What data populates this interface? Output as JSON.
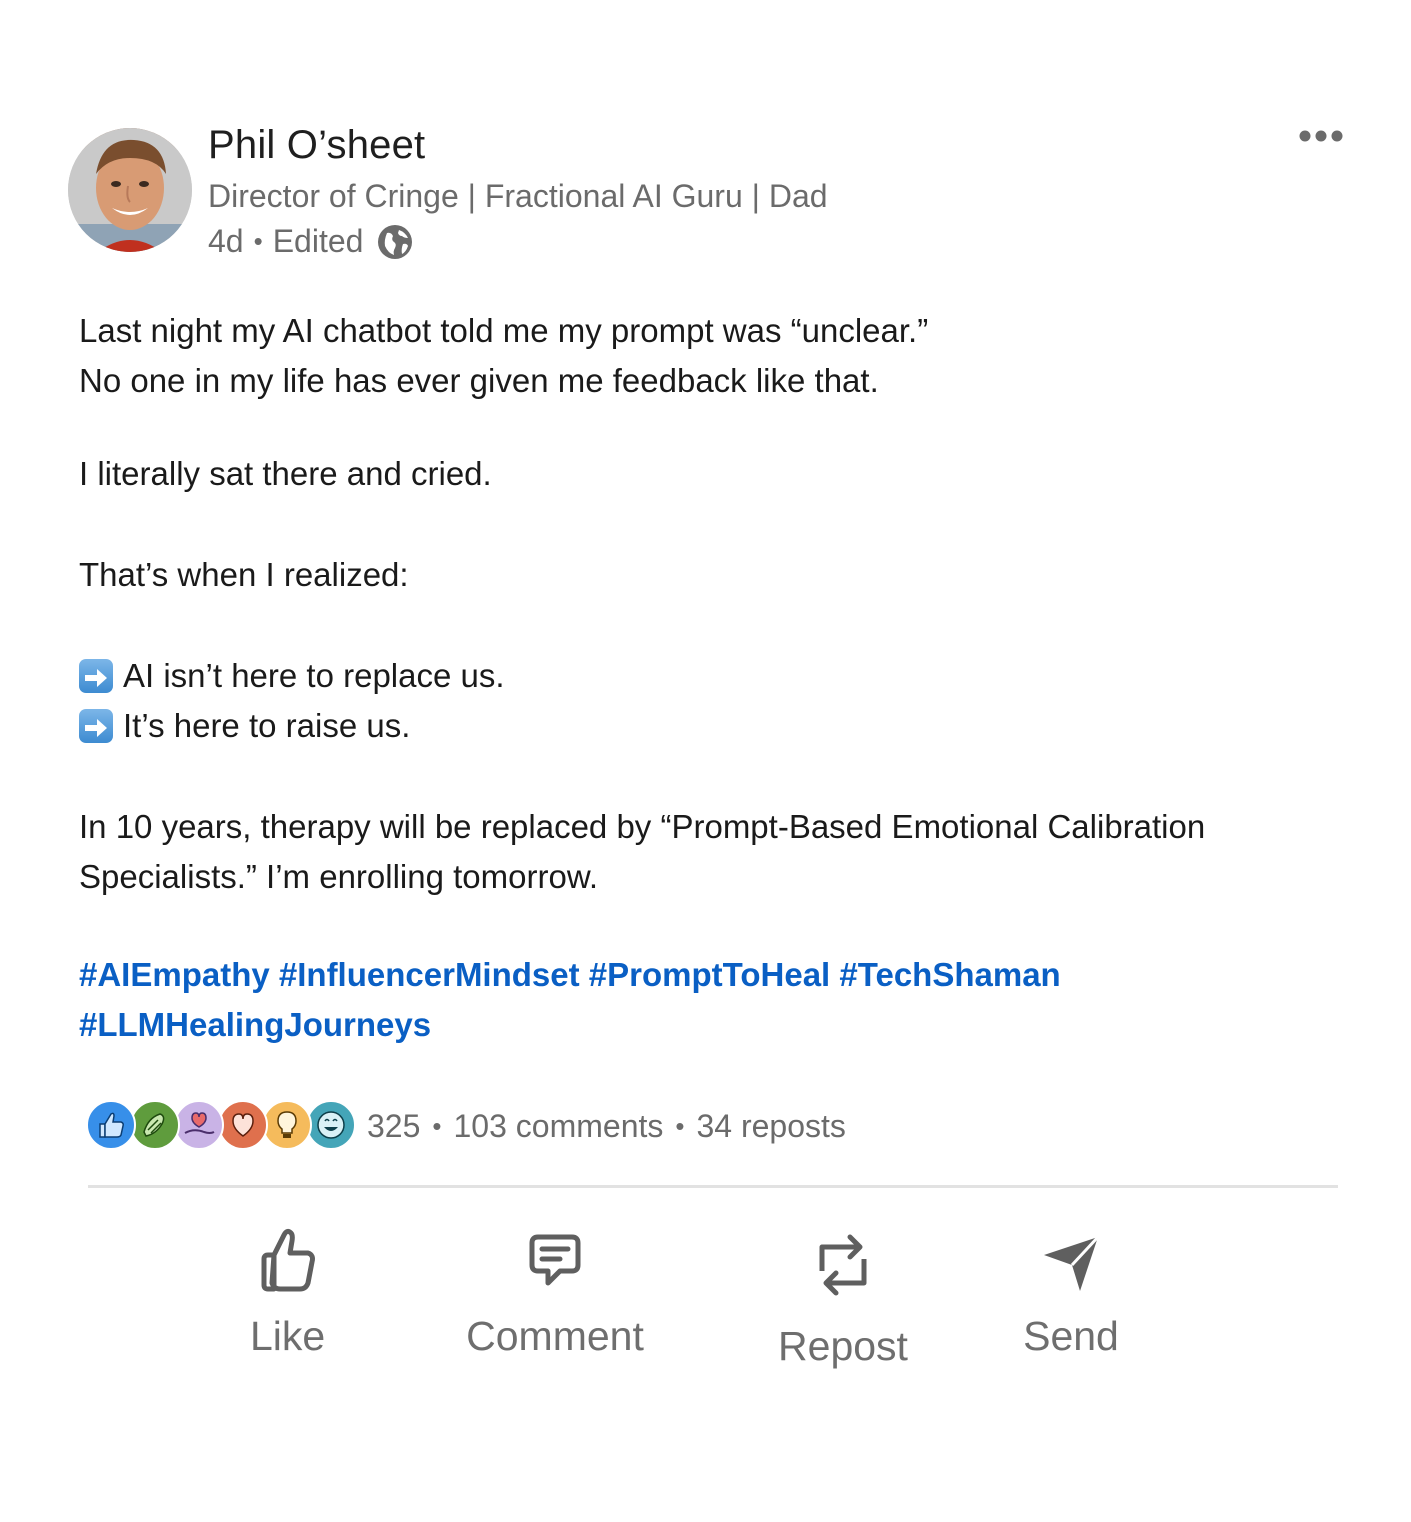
{
  "post": {
    "author": {
      "name": "Phil O’sheet",
      "headline": "Director of Cringe | Fractional AI Guru | Dad",
      "time": "4d",
      "edited": "Edited",
      "visibility_icon": "globe-icon"
    },
    "body": {
      "line1": "Last night my AI chatbot told me my prompt was “unclear.”",
      "line2": "No one in my life has ever given me feedback like that.",
      "line3": "I literally sat there and cried.",
      "line4": "That’s when I realized:",
      "bullet1": "AI isn’t here to replace us.",
      "bullet2": "It’s here to raise us.",
      "line5": "In 10 years, therapy will be replaced by “Prompt-Based Emotional Calibration",
      "line6": "Specialists.” I’m enrolling tomorrow.",
      "bullet_icon": "right-arrow-emoji-icon"
    },
    "hashtags": [
      "#AIEmpathy",
      "#InfluencerMindset",
      "#PromptToHeal",
      "#TechShaman",
      "#LLMHealingJourneys"
    ],
    "stats": {
      "reactions": "325",
      "comments": "103 comments",
      "reposts": "34 reposts"
    },
    "reaction_icons": [
      "like-icon",
      "celebrate-icon",
      "support-icon",
      "love-icon",
      "insightful-icon",
      "funny-icon"
    ],
    "actions": {
      "like": "Like",
      "comment": "Comment",
      "repost": "Repost",
      "send": "Send"
    },
    "colors": {
      "hashtag": "#0a5fc4",
      "muted_text": "#6b6b6b",
      "action_text": "#6e6e6e"
    }
  }
}
